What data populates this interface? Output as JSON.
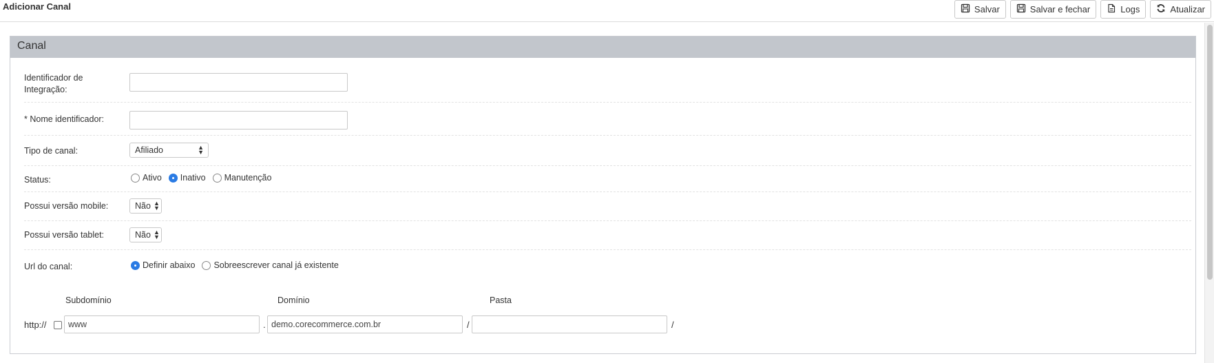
{
  "header": {
    "title": "Adicionar Canal",
    "buttons": {
      "save": "Salvar",
      "save_close": "Salvar e fechar",
      "logs": "Logs",
      "refresh": "Atualizar"
    }
  },
  "panel": {
    "title": "Canal",
    "fields": {
      "integration_id": {
        "label_line1": "Identificador de",
        "label_line2": "Integração:",
        "value": ""
      },
      "name": {
        "label": "* Nome identificador:",
        "value": ""
      },
      "channel_type": {
        "label": "Tipo de canal:",
        "selected": "Afiliado"
      },
      "status": {
        "label": "Status:",
        "options": [
          "Ativo",
          "Inativo",
          "Manutenção"
        ],
        "selected": "Inativo"
      },
      "mobile": {
        "label": "Possui versão mobile:",
        "selected": "Não"
      },
      "tablet": {
        "label": "Possui versão tablet:",
        "selected": "Não"
      },
      "url_mode": {
        "label": "Url do canal:",
        "options": [
          "Definir abaixo",
          "Sobreescrever canal já existente"
        ],
        "selected": "Definir abaixo"
      }
    },
    "url": {
      "headers": {
        "subdomain": "Subdomínio",
        "domain": "Domínio",
        "folder": "Pasta"
      },
      "protocol": "http://",
      "dot": ".",
      "slash": "/",
      "subdomain_value": "www",
      "domain_value": "demo.corecommerce.com.br",
      "folder_value": ""
    }
  },
  "icons": {
    "save": "floppy-disk-icon",
    "save_close": "floppy-disk-icon",
    "logs": "document-icon",
    "refresh": "refresh-icon"
  },
  "colors": {
    "panel_header": "#c2c6cc",
    "radio_selected": "#2a7be4"
  }
}
